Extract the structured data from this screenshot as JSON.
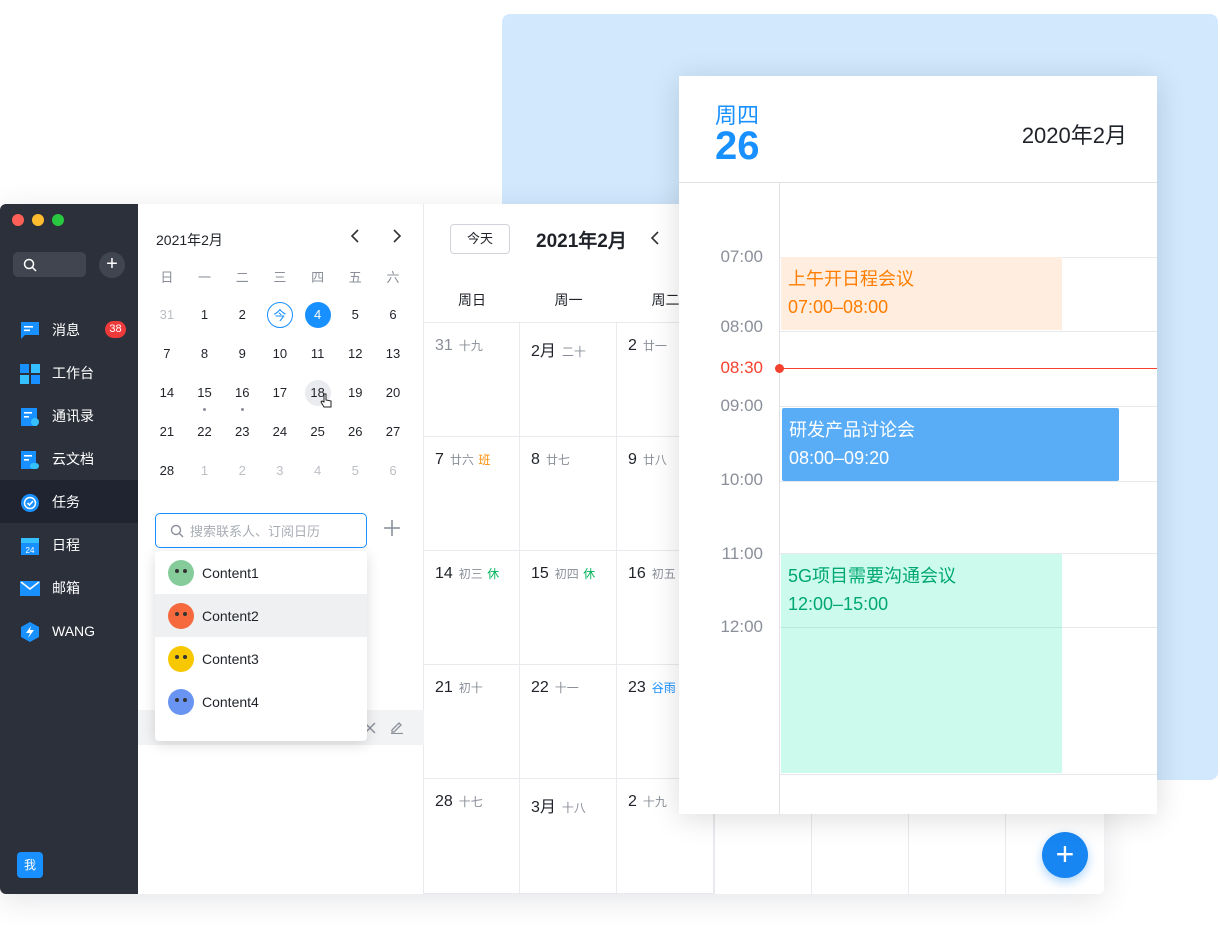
{
  "sidebar": {
    "items": [
      {
        "label": "消息",
        "icon": "message-icon",
        "color": "#1890ff"
      },
      {
        "label": "工作台",
        "icon": "workbench-icon",
        "color": "#1890ff"
      },
      {
        "label": "通讯录",
        "icon": "contacts-icon",
        "color": "#1890ff"
      },
      {
        "label": "云文档",
        "icon": "cloud-doc-icon",
        "color": "#1890ff"
      },
      {
        "label": "任务",
        "icon": "task-icon",
        "color": "#1890ff"
      },
      {
        "label": "日程",
        "icon": "calendar-icon",
        "color": "#1890ff"
      },
      {
        "label": "邮箱",
        "icon": "mail-icon",
        "color": "#1890ff"
      },
      {
        "label": "WANG",
        "icon": "wang-icon",
        "color": "#1890ff"
      }
    ],
    "badge": "38",
    "active_item": "任务",
    "me_label": "我"
  },
  "mini_calendar": {
    "title": "2021年2月",
    "weekdays": [
      "日",
      "一",
      "二",
      "三",
      "四",
      "五",
      "六"
    ],
    "rows": [
      [
        "31",
        "1",
        "2",
        "今",
        "4",
        "5",
        "6"
      ],
      [
        "7",
        "8",
        "9",
        "10",
        "11",
        "12",
        "13"
      ],
      [
        "14",
        "15",
        "16",
        "17",
        "18",
        "19",
        "20"
      ],
      [
        "21",
        "22",
        "23",
        "24",
        "25",
        "26",
        "27"
      ],
      [
        "28",
        "1",
        "2",
        "3",
        "4",
        "5",
        "6"
      ]
    ],
    "search_placeholder": "搜索联系人、订阅日历",
    "contacts": [
      "Content1",
      "Content2",
      "Content3",
      "Content4"
    ]
  },
  "month_view": {
    "today_button": "今天",
    "title": "2021年2月",
    "weekday_headers": [
      "周日",
      "周一",
      "周二"
    ],
    "weeks": [
      [
        {
          "day": "31",
          "lunar": "十九"
        },
        {
          "day": "2月",
          "lunar": "二十"
        },
        {
          "day": "2",
          "lunar": "廿一"
        }
      ],
      [
        {
          "day": "7",
          "lunar": "廿六",
          "tag": "班"
        },
        {
          "day": "8",
          "lunar": "廿七"
        },
        {
          "day": "9",
          "lunar": "廿八"
        }
      ],
      [
        {
          "day": "14",
          "lunar": "初三",
          "tag": "休"
        },
        {
          "day": "15",
          "lunar": "初四",
          "tag": "休"
        },
        {
          "day": "16",
          "lunar": "初五"
        }
      ],
      [
        {
          "day": "21",
          "lunar": "初十"
        },
        {
          "day": "22",
          "lunar": "十一"
        },
        {
          "day": "23",
          "lunar": "谷雨"
        }
      ],
      [
        {
          "day": "28",
          "lunar": "十七"
        },
        {
          "day": "3月",
          "lunar": "十八"
        },
        {
          "day": "2",
          "lunar": "十九"
        }
      ]
    ]
  },
  "day_view": {
    "weekday": "周四",
    "date": "26",
    "month_title": "2020年2月",
    "current_time": "08:30",
    "time_labels": [
      "07:00",
      "08:00",
      "09:00",
      "10:00",
      "11:00",
      "12:00"
    ],
    "events": [
      {
        "title": "上午开日程会议",
        "time": "07:00–08:00",
        "color": "#ff7d00",
        "bg": "#ffeee0"
      },
      {
        "title": "研发产品讨论会",
        "time": "08:00–09:20",
        "color": "#ffffff",
        "bg": "#59adf7"
      },
      {
        "title": "5G项目需要沟通会议",
        "time": "12:00–15:00",
        "color": "#00a870",
        "bg": "#ccfbee"
      }
    ]
  }
}
